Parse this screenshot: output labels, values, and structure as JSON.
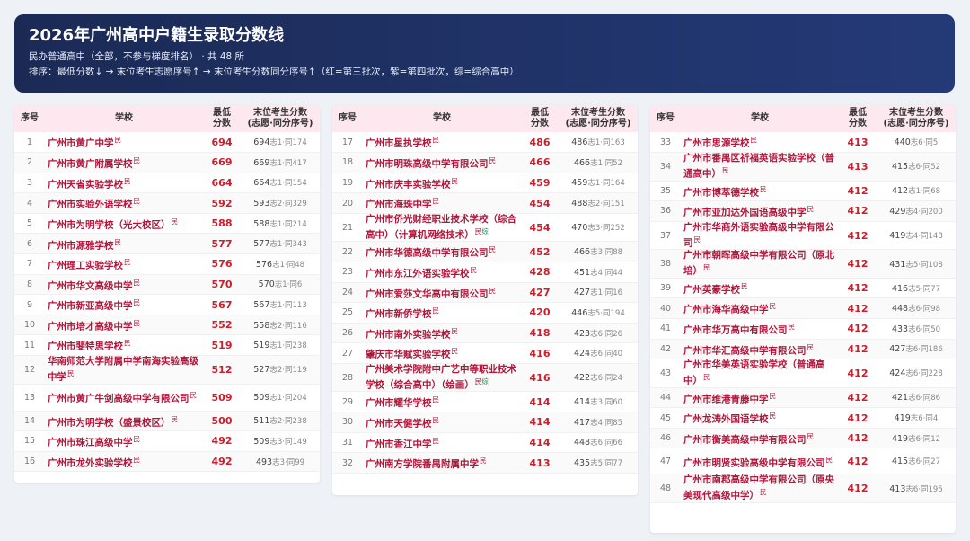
{
  "header": {
    "title": "2026年广州高中户籍生录取分数线",
    "subtitle": "民办普通高中（全部，不参与梯度排名） · 共 48 所",
    "sort_note": "排序：最低分数↓ → 末位考生志愿序号↑ → 末位考生分数同分序号↑（红=第三批次，紫=第四批次，综=综合高中）"
  },
  "columns": {
    "idx": "序号",
    "school": "学校",
    "score_line1": "最低",
    "score_line2": "分数",
    "rank_line1": "末位考生分数",
    "rank_line2": "(志愿·同分序号)"
  },
  "panels": [
    [
      {
        "idx": "1",
        "school": "广州市黄广中学",
        "tag": "民",
        "score": "694",
        "rank": "694",
        "rank2": "志1·同174"
      },
      {
        "idx": "2",
        "school": "广州市黄广附属学校",
        "tag": "民",
        "score": "669",
        "rank": "669",
        "rank2": "志1·同417"
      },
      {
        "idx": "3",
        "school": "广州天省实验学校",
        "tag": "民",
        "score": "664",
        "rank": "664",
        "rank2": "志1·同154"
      },
      {
        "idx": "4",
        "school": "广州市实验外语学校",
        "tag": "民",
        "score": "592",
        "rank": "593",
        "rank2": "志2·同329"
      },
      {
        "idx": "5",
        "school": "广州市为明学校（光大校区）",
        "tag": "民",
        "score": "588",
        "rank": "588",
        "rank2": "志1·同214"
      },
      {
        "idx": "6",
        "school": "广州市源雅学校",
        "tag": "民",
        "score": "577",
        "rank": "577",
        "rank2": "志1·同343"
      },
      {
        "idx": "7",
        "school": "广州理工实验学校",
        "tag": "民",
        "score": "576",
        "rank": "576",
        "rank2": "志1·同48"
      },
      {
        "idx": "8",
        "school": "广州市华文高级中学",
        "tag": "民",
        "score": "570",
        "rank": "570",
        "rank2": "志1·同6"
      },
      {
        "idx": "9",
        "school": "广州市新亚高级中学",
        "tag": "民",
        "score": "567",
        "rank": "567",
        "rank2": "志1·同113"
      },
      {
        "idx": "10",
        "school": "广州市培才高级中学",
        "tag": "民",
        "score": "552",
        "rank": "558",
        "rank2": "志2·同116"
      },
      {
        "idx": "11",
        "school": "广州市斐特思学校",
        "tag": "民",
        "score": "519",
        "rank": "519",
        "rank2": "志1·同238"
      },
      {
        "idx": "12",
        "school": "华南师范大学附属中学南海实验高级中学",
        "tag": "民",
        "score": "512",
        "rank": "527",
        "rank2": "志2·同119",
        "tall": true
      },
      {
        "idx": "13",
        "school": "广州市黄广牛剑高级中学有限公司",
        "tag": "民",
        "score": "509",
        "rank": "509",
        "rank2": "志1·同204",
        "tall": true
      },
      {
        "idx": "14",
        "school": "广州市为明学校（盛景校区）",
        "tag": "民",
        "score": "500",
        "rank": "511",
        "rank2": "志2·同238"
      },
      {
        "idx": "15",
        "school": "广州市珠江高级中学",
        "tag": "民",
        "score": "492",
        "rank": "509",
        "rank2": "志3·同149"
      },
      {
        "idx": "16",
        "school": "广州市龙外实验学校",
        "tag": "民",
        "score": "492",
        "rank": "493",
        "rank2": "志3·同99"
      }
    ],
    [
      {
        "idx": "17",
        "school": "广州市星执学校",
        "tag": "民",
        "score": "486",
        "rank": "486",
        "rank2": "志1·同163"
      },
      {
        "idx": "18",
        "school": "广州市明珠高级中学有限公司",
        "tag": "民",
        "score": "466",
        "rank": "466",
        "rank2": "志1·同52"
      },
      {
        "idx": "19",
        "school": "广州市庆丰实验学校",
        "tag": "民",
        "score": "459",
        "rank": "459",
        "rank2": "志1·同164"
      },
      {
        "idx": "20",
        "school": "广州市海珠中学",
        "tag": "民",
        "score": "454",
        "rank": "488",
        "rank2": "志2·同151"
      },
      {
        "idx": "21",
        "school": "广州市侨光财经职业技术学校（综合高中）（计算机网络技术）",
        "tag": "民",
        "tag2": "综",
        "score": "454",
        "rank": "470",
        "rank2": "志3·同252",
        "tall": true
      },
      {
        "idx": "22",
        "school": "广州市华德高级中学有限公司",
        "tag": "民",
        "score": "452",
        "rank": "466",
        "rank2": "志3·同88"
      },
      {
        "idx": "23",
        "school": "广州市东江外语实验学校",
        "tag": "民",
        "score": "428",
        "rank": "451",
        "rank2": "志4·同44"
      },
      {
        "idx": "24",
        "school": "广州市爱莎文华高中有限公司",
        "tag": "民",
        "score": "427",
        "rank": "427",
        "rank2": "志1·同16"
      },
      {
        "idx": "25",
        "school": "广州市新侨学校",
        "tag": "民",
        "score": "420",
        "rank": "446",
        "rank2": "志5·同194"
      },
      {
        "idx": "26",
        "school": "广州市南外实验学校",
        "tag": "民",
        "score": "418",
        "rank": "423",
        "rank2": "志6·同26"
      },
      {
        "idx": "27",
        "school": "肇庆市华赋实验学校",
        "tag": "民",
        "score": "416",
        "rank": "424",
        "rank2": "志6·同40"
      },
      {
        "idx": "28",
        "school": "广州美术学院附中广艺中等职业技术学校（综合高中）（绘画）",
        "tag": "民",
        "tag2": "综",
        "score": "416",
        "rank": "422",
        "rank2": "志6·同24",
        "tall": true
      },
      {
        "idx": "29",
        "school": "广州市耀华学校",
        "tag": "民",
        "score": "414",
        "rank": "414",
        "rank2": "志3·同60"
      },
      {
        "idx": "30",
        "school": "广州市天健学校",
        "tag": "民",
        "score": "414",
        "rank": "417",
        "rank2": "志4·同85"
      },
      {
        "idx": "31",
        "school": "广州市香江中学",
        "tag": "民",
        "score": "414",
        "rank": "448",
        "rank2": "志6·同66"
      },
      {
        "idx": "32",
        "school": "广州南方学院番禺附属中学",
        "tag": "民",
        "score": "413",
        "rank": "435",
        "rank2": "志5·同77"
      }
    ],
    [
      {
        "idx": "33",
        "school": "广州市思源学校",
        "tag": "民",
        "score": "413",
        "rank": "440",
        "rank2": "志6·同5"
      },
      {
        "idx": "34",
        "school": "广州市番禺区祈福英语实验学校（普通高中）",
        "tag": "民",
        "score": "413",
        "rank": "415",
        "rank2": "志6·同52",
        "tall": true
      },
      {
        "idx": "35",
        "school": "广州市博萃德学校",
        "tag": "民",
        "score": "412",
        "rank": "412",
        "rank2": "志1·同68"
      },
      {
        "idx": "36",
        "school": "广州市亚加达外国语高级中学",
        "tag": "民",
        "score": "412",
        "rank": "429",
        "rank2": "志4·同200"
      },
      {
        "idx": "37",
        "school": "广州市华商外语实验高级中学有限公司",
        "tag": "民",
        "score": "412",
        "rank": "419",
        "rank2": "志4·同148",
        "tall": true
      },
      {
        "idx": "38",
        "school": "广州市朝晖高级中学有限公司（原北培）",
        "tag": "民",
        "score": "412",
        "rank": "431",
        "rank2": "志5·同108",
        "tall": true
      },
      {
        "idx": "39",
        "school": "广州英豪学校",
        "tag": "民",
        "score": "412",
        "rank": "416",
        "rank2": "志5·同77"
      },
      {
        "idx": "40",
        "school": "广州市海华高级中学",
        "tag": "民",
        "score": "412",
        "rank": "448",
        "rank2": "志6·同98"
      },
      {
        "idx": "41",
        "school": "广州市华万高中有限公司",
        "tag": "民",
        "score": "412",
        "rank": "433",
        "rank2": "志6·同50"
      },
      {
        "idx": "42",
        "school": "广州市华汇高级中学有限公司",
        "tag": "民",
        "score": "412",
        "rank": "427",
        "rank2": "志6·同186"
      },
      {
        "idx": "43",
        "school": "广州市华美英语实验学校（普通高中）",
        "tag": "民",
        "score": "412",
        "rank": "424",
        "rank2": "志6·同228",
        "tall": true
      },
      {
        "idx": "44",
        "school": "广州市维港青藤中学",
        "tag": "民",
        "score": "412",
        "rank": "421",
        "rank2": "志6·同86"
      },
      {
        "idx": "45",
        "school": "广州龙涛外国语学校",
        "tag": "民",
        "score": "412",
        "rank": "419",
        "rank2": "志6·同4"
      },
      {
        "idx": "46",
        "school": "广州市衡美高级中学有限公司",
        "tag": "民",
        "score": "412",
        "rank": "419",
        "rank2": "志6·同12"
      },
      {
        "idx": "47",
        "school": "广州市明贤实验高级中学有限公司",
        "tag": "民",
        "score": "412",
        "rank": "415",
        "rank2": "志6·同27",
        "tall": true
      },
      {
        "idx": "48",
        "school": "广州市南郡高级中学有限公司（原央美现代高级中学）",
        "tag": "民",
        "score": "412",
        "rank": "413",
        "rank2": "志6·同195",
        "tall": true
      }
    ]
  ]
}
